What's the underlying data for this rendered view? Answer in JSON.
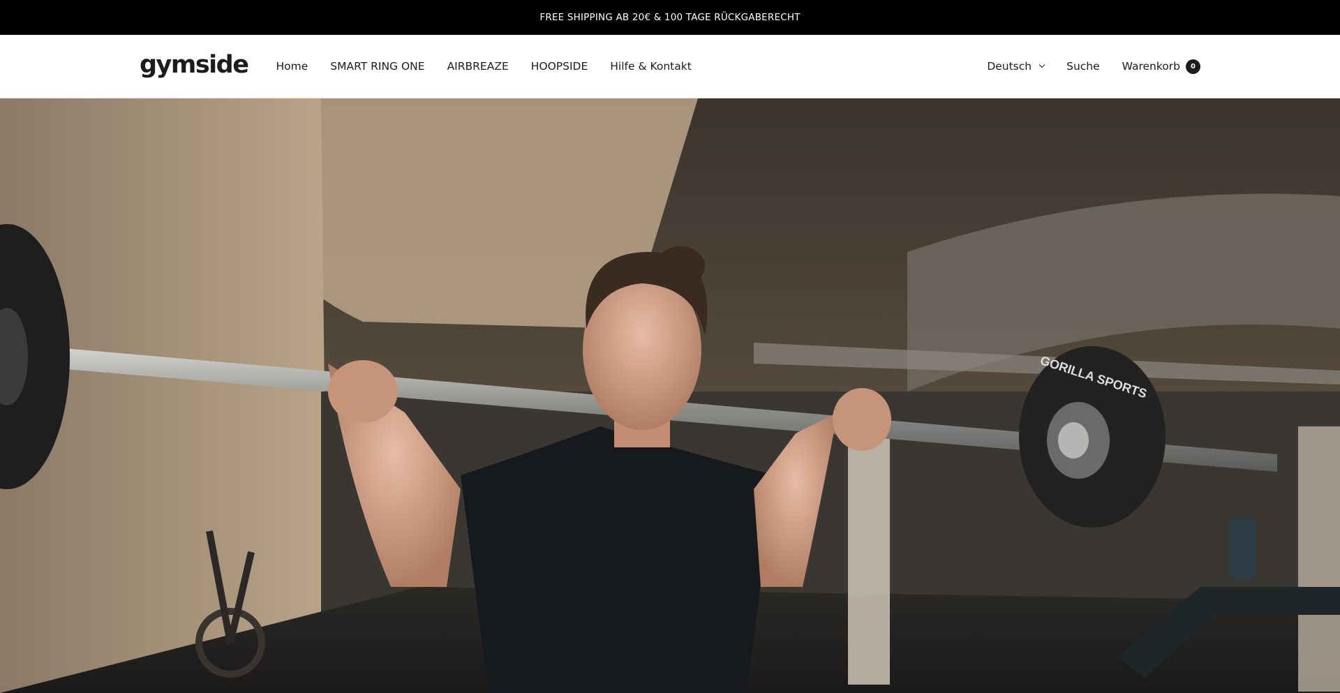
{
  "announcement": {
    "text": "FREE SHIPPING AB 20€ & 100 TAGE RÜCKGABERECHT"
  },
  "header": {
    "logo": "gymside",
    "nav": [
      {
        "label": "Home"
      },
      {
        "label": "SMART RING ONE"
      },
      {
        "label": "AIRBREAZE"
      },
      {
        "label": "HOOPSIDE"
      },
      {
        "label": "Hilfe & Kontakt"
      }
    ],
    "language": {
      "label": "Deutsch",
      "icon": "chevron-down-icon"
    },
    "search": {
      "label": "Suche"
    },
    "cart": {
      "label": "Warenkorb",
      "count": "0"
    }
  },
  "hero": {
    "image_alt": "Woman doing barbell squat in a gym",
    "plate_text": "GORILLA SPORTS"
  },
  "colors": {
    "bar_bg": "#000000",
    "text": "#1c1c1c",
    "background": "#ffffff"
  }
}
